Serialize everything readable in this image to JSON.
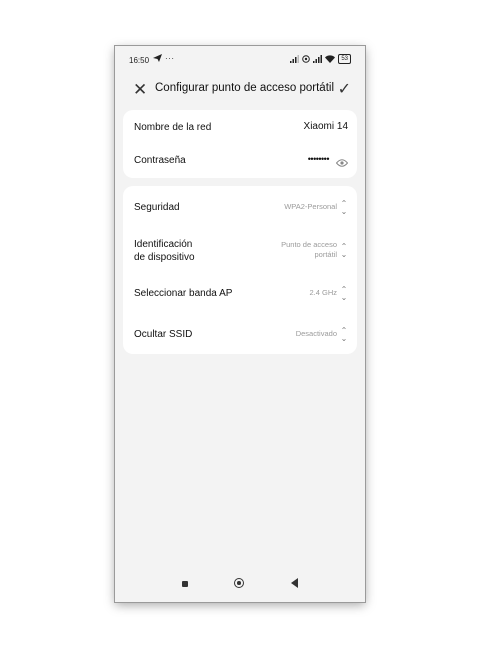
{
  "status_bar": {
    "time": "16:50",
    "send_icon": "send-icon",
    "dots": "···",
    "signal_icon": "signal-icon",
    "battery": "53"
  },
  "header": {
    "title": "Configurar punto de acceso portátil",
    "close_icon": "close-icon",
    "confirm_icon": "checkmark-icon"
  },
  "network": {
    "name_label": "Nombre de la red",
    "name_value": "Xiaomi 14",
    "password_label": "Contraseña",
    "password_value": "••••••••",
    "visibility_icon": "eye-icon"
  },
  "settings": {
    "security_label": "Seguridad",
    "security_value": "WPA2-Personal",
    "device_id_label_1": "Identificación",
    "device_id_label_2": "de dispositivo",
    "device_id_value_1": "Punto de acceso",
    "device_id_value_2": "portátil",
    "band_label": "Seleccionar banda AP",
    "band_value": "2.4 GHz",
    "hide_ssid_label": "Ocultar SSID",
    "hide_ssid_value": "Desactivado"
  },
  "nav": {
    "recents_icon": "recents-icon",
    "home_icon": "home-icon",
    "back_icon": "back-icon"
  }
}
